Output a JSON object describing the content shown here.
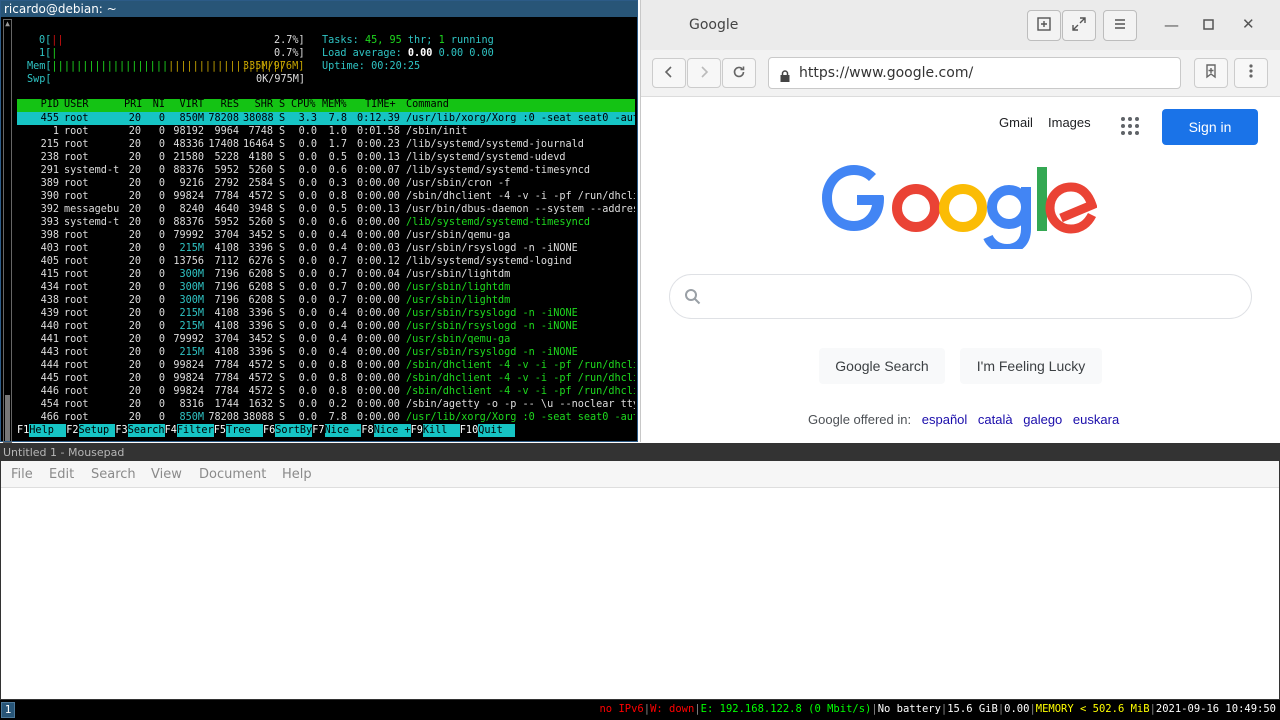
{
  "terminal": {
    "title": "ricardo@debian: ~",
    "meters": {
      "cpu0_label": "0[",
      "cpu0_bar": "||",
      "cpu0_value": "2.7%]",
      "cpu1_label": "1[",
      "cpu1_bar": "|",
      "cpu1_value": "0.7%]",
      "mem_label": "Mem[",
      "mem_bar_green": "|||||||||||||||||||",
      "mem_bar_yellow": "|||||||||||||||||||",
      "mem_value": "335M/976M]",
      "swp_label": "Swp[",
      "swp_value": "0K/975M]",
      "tasks_label": "Tasks:",
      "tasks_value": "45, 95",
      "thr_label": "thr;",
      "thr_value": "1",
      "running_label": "running",
      "load_label": "Load average:",
      "load_1": "0.00",
      "load_5": "0.00",
      "load_15": "0.00",
      "uptime_label": "Uptime:",
      "uptime_value": "00:20:25"
    },
    "columns": {
      "pid": "PID",
      "user": "USER",
      "pri": "PRI",
      "ni": "NI",
      "virt": "VIRT",
      "res": "RES",
      "shr": "SHR",
      "s": "S",
      "cpu": "CPU%",
      "mem": "MEM%",
      "time": "TIME+",
      "command": "Command"
    },
    "processes": [
      {
        "pid": "455",
        "user": "root",
        "pri": "20",
        "ni": "0",
        "virt": "850M",
        "res": "78208",
        "shr": "38088",
        "s": "S",
        "cpu": "3.3",
        "mem": "7.8",
        "time": "0:12.39",
        "command": "/usr/lib/xorg/Xorg :0 -seat seat0 -aut",
        "thread": false
      },
      {
        "pid": "1",
        "user": "root",
        "pri": "20",
        "ni": "0",
        "virt": "98192",
        "res": "9964",
        "shr": "7748",
        "s": "S",
        "cpu": "0.0",
        "mem": "1.0",
        "time": "0:01.58",
        "command": "/sbin/init",
        "thread": false
      },
      {
        "pid": "215",
        "user": "root",
        "pri": "20",
        "ni": "0",
        "virt": "48336",
        "res": "17408",
        "shr": "16464",
        "s": "S",
        "cpu": "0.0",
        "mem": "1.7",
        "time": "0:00.23",
        "command": "/lib/systemd/systemd-journald",
        "thread": false
      },
      {
        "pid": "238",
        "user": "root",
        "pri": "20",
        "ni": "0",
        "virt": "21580",
        "res": "5228",
        "shr": "4180",
        "s": "S",
        "cpu": "0.0",
        "mem": "0.5",
        "time": "0:00.13",
        "command": "/lib/systemd/systemd-udevd",
        "thread": false
      },
      {
        "pid": "291",
        "user": "systemd-t",
        "pri": "20",
        "ni": "0",
        "virt": "88376",
        "res": "5952",
        "shr": "5260",
        "s": "S",
        "cpu": "0.0",
        "mem": "0.6",
        "time": "0:00.07",
        "command": "/lib/systemd/systemd-timesyncd",
        "thread": false
      },
      {
        "pid": "389",
        "user": "root",
        "pri": "20",
        "ni": "0",
        "virt": "9216",
        "res": "2792",
        "shr": "2584",
        "s": "S",
        "cpu": "0.0",
        "mem": "0.3",
        "time": "0:00.00",
        "command": "/usr/sbin/cron -f",
        "thread": false
      },
      {
        "pid": "390",
        "user": "root",
        "pri": "20",
        "ni": "0",
        "virt": "99824",
        "res": "7784",
        "shr": "4572",
        "s": "S",
        "cpu": "0.0",
        "mem": "0.8",
        "time": "0:00.00",
        "command": "/sbin/dhclient -4 -v -i -pf /run/dhcli",
        "thread": false
      },
      {
        "pid": "392",
        "user": "messagebu",
        "pri": "20",
        "ni": "0",
        "virt": "8240",
        "res": "4640",
        "shr": "3948",
        "s": "S",
        "cpu": "0.0",
        "mem": "0.5",
        "time": "0:00.13",
        "command": "/usr/bin/dbus-daemon --system --addres",
        "thread": false
      },
      {
        "pid": "393",
        "user": "systemd-t",
        "pri": "20",
        "ni": "0",
        "virt": "88376",
        "res": "5952",
        "shr": "5260",
        "s": "S",
        "cpu": "0.0",
        "mem": "0.6",
        "time": "0:00.00",
        "command": "/lib/systemd/systemd-timesyncd",
        "thread": true
      },
      {
        "pid": "398",
        "user": "root",
        "pri": "20",
        "ni": "0",
        "virt": "79992",
        "res": "3704",
        "shr": "3452",
        "s": "S",
        "cpu": "0.0",
        "mem": "0.4",
        "time": "0:00.00",
        "command": "/usr/sbin/qemu-ga",
        "thread": false
      },
      {
        "pid": "403",
        "user": "root",
        "pri": "20",
        "ni": "0",
        "virt": "215M",
        "res": "4108",
        "shr": "3396",
        "s": "S",
        "cpu": "0.0",
        "mem": "0.4",
        "time": "0:00.03",
        "command": "/usr/sbin/rsyslogd -n -iNONE",
        "thread": false
      },
      {
        "pid": "405",
        "user": "root",
        "pri": "20",
        "ni": "0",
        "virt": "13756",
        "res": "7112",
        "shr": "6276",
        "s": "S",
        "cpu": "0.0",
        "mem": "0.7",
        "time": "0:00.12",
        "command": "/lib/systemd/systemd-logind",
        "thread": false
      },
      {
        "pid": "415",
        "user": "root",
        "pri": "20",
        "ni": "0",
        "virt": "300M",
        "res": "7196",
        "shr": "6208",
        "s": "S",
        "cpu": "0.0",
        "mem": "0.7",
        "time": "0:00.04",
        "command": "/usr/sbin/lightdm",
        "thread": false
      },
      {
        "pid": "434",
        "user": "root",
        "pri": "20",
        "ni": "0",
        "virt": "300M",
        "res": "7196",
        "shr": "6208",
        "s": "S",
        "cpu": "0.0",
        "mem": "0.7",
        "time": "0:00.00",
        "command": "/usr/sbin/lightdm",
        "thread": true
      },
      {
        "pid": "438",
        "user": "root",
        "pri": "20",
        "ni": "0",
        "virt": "300M",
        "res": "7196",
        "shr": "6208",
        "s": "S",
        "cpu": "0.0",
        "mem": "0.7",
        "time": "0:00.00",
        "command": "/usr/sbin/lightdm",
        "thread": true
      },
      {
        "pid": "439",
        "user": "root",
        "pri": "20",
        "ni": "0",
        "virt": "215M",
        "res": "4108",
        "shr": "3396",
        "s": "S",
        "cpu": "0.0",
        "mem": "0.4",
        "time": "0:00.00",
        "command": "/usr/sbin/rsyslogd -n -iNONE",
        "thread": true
      },
      {
        "pid": "440",
        "user": "root",
        "pri": "20",
        "ni": "0",
        "virt": "215M",
        "res": "4108",
        "shr": "3396",
        "s": "S",
        "cpu": "0.0",
        "mem": "0.4",
        "time": "0:00.00",
        "command": "/usr/sbin/rsyslogd -n -iNONE",
        "thread": true
      },
      {
        "pid": "441",
        "user": "root",
        "pri": "20",
        "ni": "0",
        "virt": "79992",
        "res": "3704",
        "shr": "3452",
        "s": "S",
        "cpu": "0.0",
        "mem": "0.4",
        "time": "0:00.00",
        "command": "/usr/sbin/qemu-ga",
        "thread": true
      },
      {
        "pid": "443",
        "user": "root",
        "pri": "20",
        "ni": "0",
        "virt": "215M",
        "res": "4108",
        "shr": "3396",
        "s": "S",
        "cpu": "0.0",
        "mem": "0.4",
        "time": "0:00.00",
        "command": "/usr/sbin/rsyslogd -n -iNONE",
        "thread": true
      },
      {
        "pid": "444",
        "user": "root",
        "pri": "20",
        "ni": "0",
        "virt": "99824",
        "res": "7784",
        "shr": "4572",
        "s": "S",
        "cpu": "0.0",
        "mem": "0.8",
        "time": "0:00.00",
        "command": "/sbin/dhclient -4 -v -i -pf /run/dhcli",
        "thread": true
      },
      {
        "pid": "445",
        "user": "root",
        "pri": "20",
        "ni": "0",
        "virt": "99824",
        "res": "7784",
        "shr": "4572",
        "s": "S",
        "cpu": "0.0",
        "mem": "0.8",
        "time": "0:00.00",
        "command": "/sbin/dhclient -4 -v -i -pf /run/dhcli",
        "thread": true
      },
      {
        "pid": "446",
        "user": "root",
        "pri": "20",
        "ni": "0",
        "virt": "99824",
        "res": "7784",
        "shr": "4572",
        "s": "S",
        "cpu": "0.0",
        "mem": "0.8",
        "time": "0:00.00",
        "command": "/sbin/dhclient -4 -v -i -pf /run/dhcli",
        "thread": true
      },
      {
        "pid": "454",
        "user": "root",
        "pri": "20",
        "ni": "0",
        "virt": "8316",
        "res": "1744",
        "shr": "1632",
        "s": "S",
        "cpu": "0.0",
        "mem": "0.2",
        "time": "0:00.00",
        "command": "/sbin/agetty -o -p -- \\u --noclear tty",
        "thread": false
      },
      {
        "pid": "466",
        "user": "root",
        "pri": "20",
        "ni": "0",
        "virt": "850M",
        "res": "78208",
        "shr": "38088",
        "s": "S",
        "cpu": "0.0",
        "mem": "7.8",
        "time": "0:00.00",
        "command": "/usr/lib/xorg/Xorg :0 -seat seat0 -aut",
        "thread": true
      }
    ],
    "fkeys": [
      {
        "key": "F1",
        "label": "Help  "
      },
      {
        "key": "F2",
        "label": "Setup "
      },
      {
        "key": "F3",
        "label": "Search"
      },
      {
        "key": "F4",
        "label": "Filter"
      },
      {
        "key": "F5",
        "label": "Tree  "
      },
      {
        "key": "F6",
        "label": "SortBy"
      },
      {
        "key": "F7",
        "label": "Nice -"
      },
      {
        "key": "F8",
        "label": "Nice +"
      },
      {
        "key": "F9",
        "label": "Kill  "
      },
      {
        "key": "F10",
        "label": "Quit  "
      }
    ]
  },
  "browser": {
    "window_title": "Google",
    "url": "https://www.google.com/",
    "links": {
      "gmail": "Gmail",
      "images": "Images"
    },
    "signin_label": "Sign in",
    "search_button": "Google Search",
    "lucky_button": "I'm Feeling Lucky",
    "offered_in": "Google offered in:",
    "languages": [
      "español",
      "català",
      "galego",
      "euskara"
    ],
    "icons": {
      "new_tab": "new-tab-icon",
      "fullscreen": "fullscreen-icon",
      "menu": "hamburger-menu-icon",
      "minimize": "minimize-icon",
      "maximize": "maximize-icon",
      "close": "close-icon",
      "back": "back-arrow-icon",
      "forward": "forward-arrow-icon",
      "reload": "reload-icon",
      "lock": "lock-icon",
      "bookmark": "bookmark-add-icon",
      "kebab": "kebab-menu-icon",
      "apps": "apps-grid-icon",
      "search": "search-icon"
    },
    "colors": {
      "signin_blue": "#1a73e8",
      "g_blue": "#4285F4",
      "g_red": "#EA4335",
      "g_yellow": "#FBBC05",
      "g_green": "#34A853"
    }
  },
  "editor": {
    "title": "Untitled 1 - Mousepad",
    "menu": [
      "File",
      "Edit",
      "Search",
      "View",
      "Document",
      "Help"
    ]
  },
  "statusbar": {
    "workspace": "1",
    "ipv6": "no IPv6",
    "wireless": "W: down",
    "ethernet": "E: 192.168.122.8 (0 Mbit/s)",
    "battery": "No battery",
    "disk": "15.6 GiB",
    "load": "0.00",
    "memory": "MEMORY < 502.6 MiB",
    "datetime": "2021-09-16 10:49:50"
  }
}
